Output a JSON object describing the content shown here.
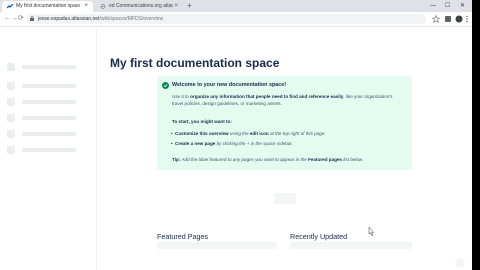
{
  "browser": {
    "tabs": [
      {
        "title": "My first documentation space",
        "active": true
      },
      {
        "title": "ed Communications.org atlassia...",
        "active": false
      }
    ],
    "new_tab_label": "+",
    "close_glyph": "×",
    "window_controls": {
      "minimize": "—",
      "maximize": "☐",
      "close": "✕"
    },
    "url_host": "jesse.espadas.atlassian.net",
    "url_path": "/wiki/spaces/MFDS/overview",
    "nav": {
      "back": "←",
      "forward": "→",
      "reload": "⟳"
    }
  },
  "page": {
    "title": "My first documentation space",
    "panel": {
      "heading": "Welcome to your new documentation space!",
      "intro_pre": "Use it to ",
      "intro_bold": "organize any information that people need to find and reference easily",
      "intro_post": ", like your organization's travel policies, design guidelines, or marketing assets.",
      "start": "To start, you might want to:",
      "bullet1_bold": "Customize this overview",
      "bullet1_mid": " using the ",
      "bullet1_bold2": "edit icon",
      "bullet1_post": " at the top right of this page.",
      "bullet2_bold": "Create a new page",
      "bullet2_post": " by clicking the + in the space sidebar.",
      "tip_label": "Tip:",
      "tip_text": " Add the label featured to any pages you want to appear in the ",
      "tip_bold": "Featured pages",
      "tip_post": " list below."
    },
    "sections": {
      "featured": "Featured Pages",
      "recent": "Recently Updated"
    }
  },
  "colors": {
    "panel_bg": "#e3fcef",
    "success_green": "#00875a",
    "skeleton": "#ebecf0",
    "heading": "#172b4d"
  }
}
